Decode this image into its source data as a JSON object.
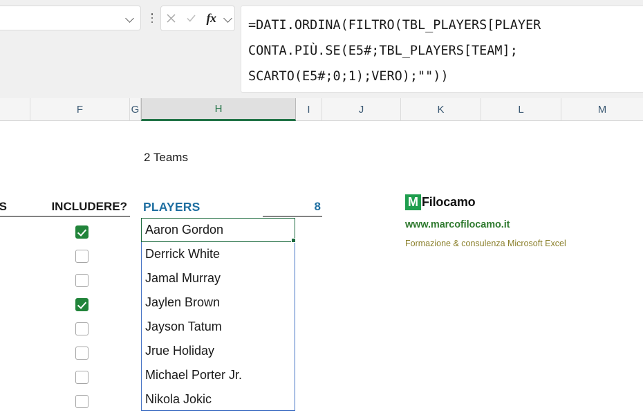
{
  "formula_bar": {
    "name_box_value": "",
    "name_box_dropdown_icon": "chevron-down-icon",
    "kebab_icon": "more-options-icon",
    "cancel_icon": "close-icon",
    "confirm_icon": "check-icon",
    "function_icon": "fx-icon",
    "expand_icon": "chevron-down-icon",
    "formula_lines": [
      "=DATI.ORDINA(FILTRO(TBL_PLAYERS[PLAYER",
      "CONTA.PIÙ.SE(E5#;TBL_PLAYERS[TEAM];",
      "SCARTO(E5#;0;1);VERO);\"\"))"
    ]
  },
  "grid": {
    "column_headers": [
      "F",
      "G",
      "H",
      "I",
      "J",
      "K",
      "L",
      "M"
    ],
    "selected_column": "H"
  },
  "sheet": {
    "teams_label": "2 Teams",
    "header_cut_left": "S",
    "header_includere": "INCLUDERE?",
    "header_players": "PLAYERS",
    "header_count": "8",
    "rows": [
      {
        "include": true,
        "player": "Aaron Gordon"
      },
      {
        "include": false,
        "player": "Derrick White"
      },
      {
        "include": false,
        "player": "Jamal Murray"
      },
      {
        "include": true,
        "player": "Jaylen Brown"
      },
      {
        "include": false,
        "player": "Jayson Tatum"
      },
      {
        "include": false,
        "player": "Jrue Holiday"
      },
      {
        "include": false,
        "player": "Michael Porter Jr."
      },
      {
        "include": false,
        "player": "Nikola Jokic"
      }
    ],
    "active_cell_value": "Aaron Gordon"
  },
  "brand": {
    "mark_letter": "M",
    "mark_color": "#1f9e4e",
    "name": "Filocamo",
    "url": "www.marcofilocamo.it",
    "url_color": "#2f7a2f",
    "tagline": "Formazione & consulenza Microsoft Excel",
    "tagline_color": "#8a7f2a"
  },
  "colors": {
    "accent_green": "#217346",
    "header_blue": "#1f6fa1",
    "spill_border": "#4472c4",
    "checkbox_green": "#21843a"
  }
}
